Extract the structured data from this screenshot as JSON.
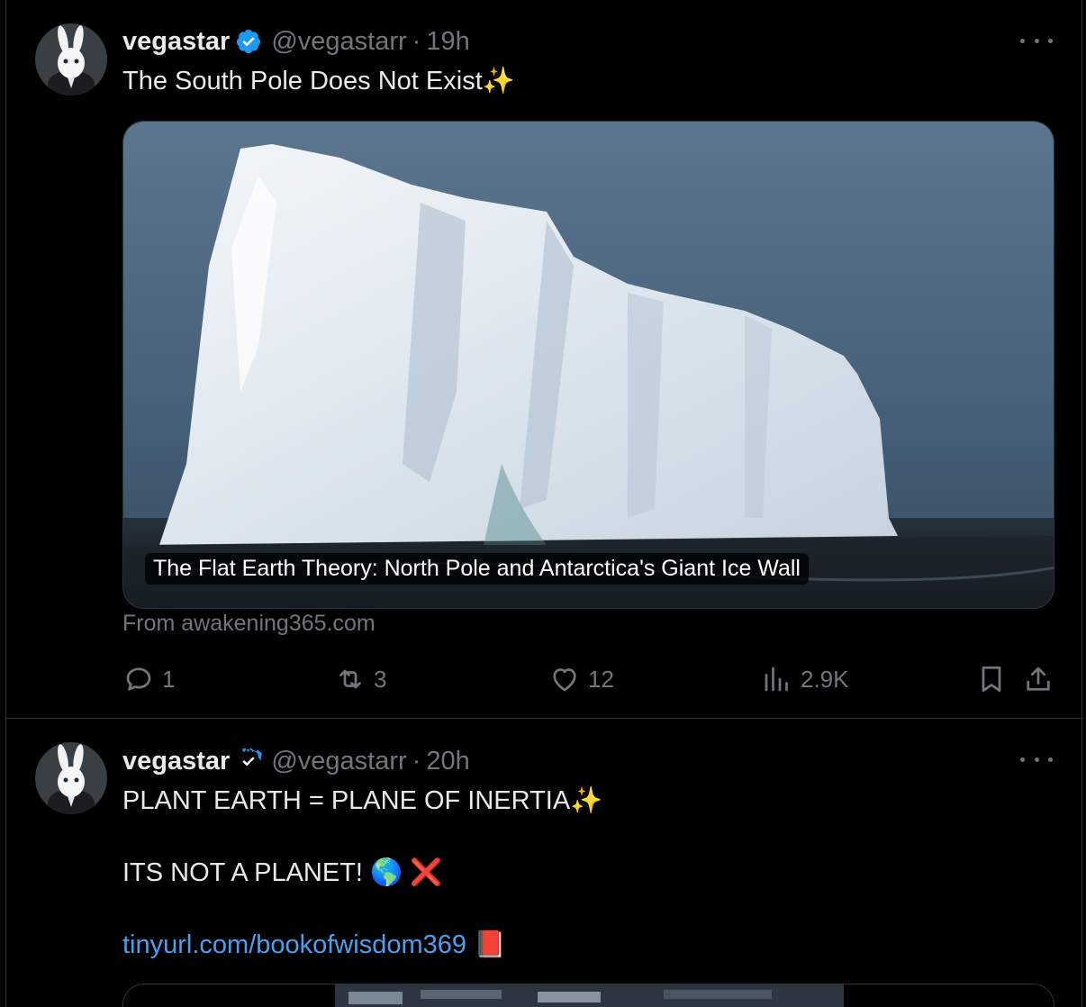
{
  "tweets": [
    {
      "author": {
        "name": "vegastar",
        "handle": "@vegastarr",
        "time": "19h",
        "avatar_icon": "white-rabbit-avatar",
        "verified_icon": "verified-badge-icon"
      },
      "text": "The South Pole Does Not Exist✨",
      "card": {
        "title": "The Flat Earth Theory: North Pole and Antarctica's Giant Ice Wall",
        "source": "From awakening365.com"
      },
      "actions": {
        "reply": "1",
        "retweet": "3",
        "like": "12",
        "views": "2.9K"
      }
    },
    {
      "author": {
        "name": "vegastar",
        "handle": "@vegastarr",
        "time": "20h",
        "avatar_icon": "white-rabbit-avatar",
        "verified_icon": "verified-badge-icon"
      },
      "lines": [
        "PLANT EARTH = PLANE OF INERTIA✨",
        "ITS NOT A PLANET! 🌎 ❌"
      ],
      "link": "tinyurl.com/bookofwisdom369",
      "link_suffix": "📕"
    }
  ],
  "colors": {
    "background": "#000000",
    "text": "#e7e9ea",
    "muted": "#71767b",
    "link": "#4c9ff0",
    "verified": "#1d9bf0",
    "divider": "#2f3336"
  }
}
